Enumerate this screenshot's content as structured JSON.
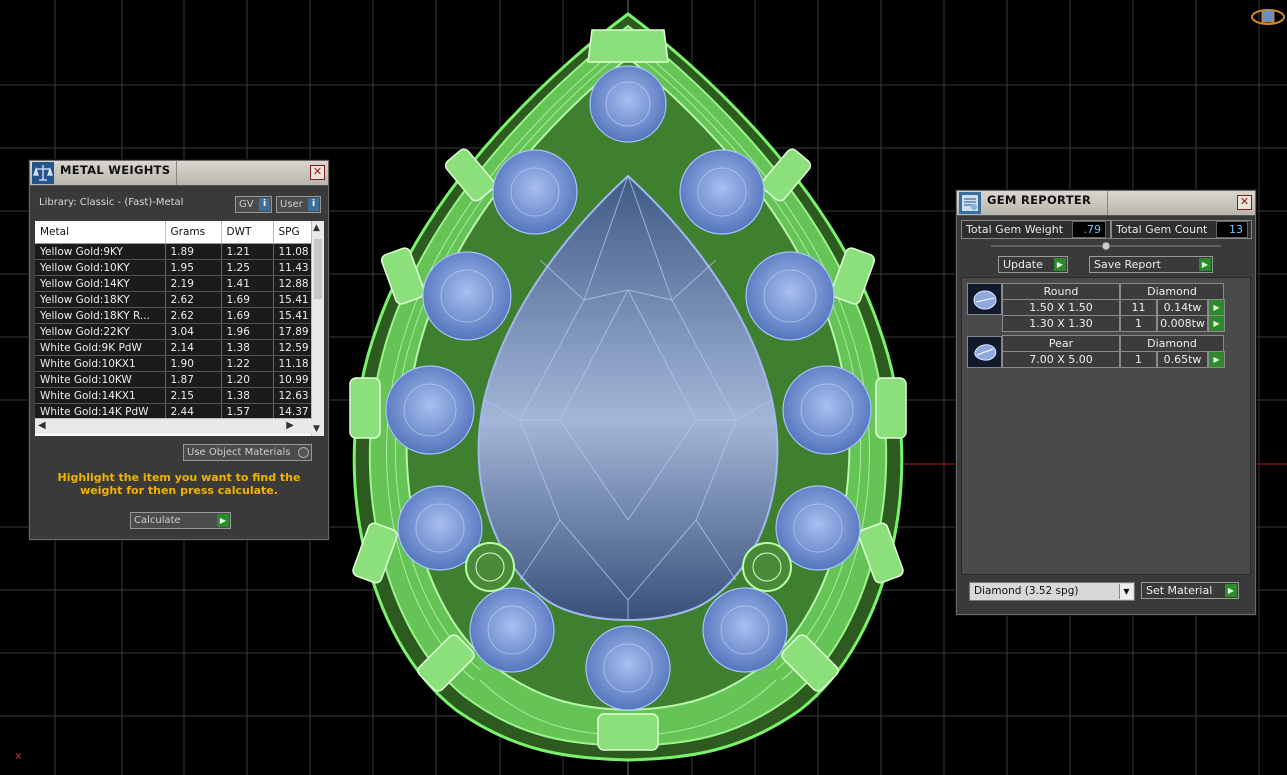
{
  "metal_weights": {
    "title": "METAL WEIGHTS",
    "library": "Library: Classic - (Fast)-Metal",
    "gv_label": "GV",
    "user_label": "User",
    "columns": [
      "Metal",
      "Grams",
      "DWT",
      "SPG"
    ],
    "rows": [
      {
        "metal": "Yellow Gold:9KY",
        "grams": "1.89",
        "dwt": "1.21",
        "spg": "11.08"
      },
      {
        "metal": "Yellow Gold:10KY",
        "grams": "1.95",
        "dwt": "1.25",
        "spg": "11.43"
      },
      {
        "metal": "Yellow Gold:14KY",
        "grams": "2.19",
        "dwt": "1.41",
        "spg": "12.88"
      },
      {
        "metal": "Yellow Gold:18KY",
        "grams": "2.62",
        "dwt": "1.69",
        "spg": "15.41"
      },
      {
        "metal": "Yellow Gold:18KY R...",
        "grams": "2.62",
        "dwt": "1.69",
        "spg": "15.41"
      },
      {
        "metal": "Yellow Gold:22KY",
        "grams": "3.04",
        "dwt": "1.96",
        "spg": "17.89"
      },
      {
        "metal": "White Gold:9K PdW",
        "grams": "2.14",
        "dwt": "1.38",
        "spg": "12.59"
      },
      {
        "metal": "White Gold:10KX1",
        "grams": "1.90",
        "dwt": "1.22",
        "spg": "11.18"
      },
      {
        "metal": "White Gold:10KW",
        "grams": "1.87",
        "dwt": "1.20",
        "spg": "10.99"
      },
      {
        "metal": "White Gold:14KX1",
        "grams": "2.15",
        "dwt": "1.38",
        "spg": "12.63"
      },
      {
        "metal": "White Gold:14K PdW",
        "grams": "2.44",
        "dwt": "1.57",
        "spg": "14.37"
      }
    ],
    "use_object_materials": "Use Object Materials",
    "hint": "Highlight the item you want to find the weight for then press calculate.",
    "calculate_label": "Calculate"
  },
  "gem_reporter": {
    "title": "GEM REPORTER",
    "total_weight_label": "Total Gem Weight",
    "total_weight_value": ".79",
    "total_count_label": "Total Gem Count",
    "total_count_value": "13",
    "update_label": "Update",
    "save_report_label": "Save Report",
    "groups": [
      {
        "shape": "Round",
        "material": "Diamond",
        "items": [
          {
            "size": "1.50 X 1.50",
            "count": "11",
            "weight": "0.14tw"
          },
          {
            "size": "1.30 X 1.30",
            "count": "1",
            "weight": "0.008tw"
          }
        ]
      },
      {
        "shape": "Pear",
        "material": "Diamond",
        "items": [
          {
            "size": "7.00 X 5.00",
            "count": "1",
            "weight": "0.65tw"
          }
        ]
      }
    ],
    "material_select": "Diamond    (3.52 spg)",
    "set_material_label": "Set Material"
  },
  "viewport": {
    "axis_marker": "x",
    "colors": {
      "background": "#000000",
      "grid": "#3a3a3a",
      "metal": "#6fe06a",
      "gem": "#7aa2e8",
      "hint": "#f0b400"
    }
  }
}
